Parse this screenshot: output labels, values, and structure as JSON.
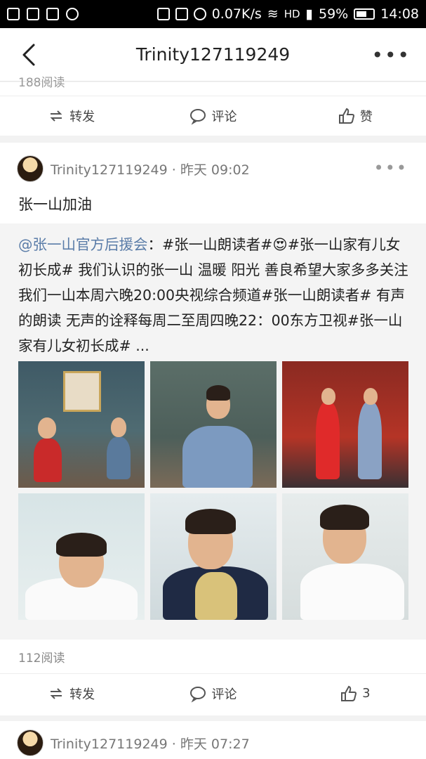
{
  "statusbar": {
    "speed": "0.07K/s",
    "network": "HD",
    "battery": "59%",
    "time": "14:08"
  },
  "navbar": {
    "title": "Trinity127119249",
    "more": "•••"
  },
  "top_card": {
    "reads_partial": "188阅读",
    "actions": {
      "forward": "转发",
      "comment": "评论",
      "like": "赞"
    }
  },
  "post1": {
    "username": "Trinity127119249",
    "sep": "·",
    "time": "昨天 09:02",
    "more": "•••",
    "text": "张一山加油",
    "repost": {
      "mention": "@张一山官方后援会",
      "body": "：#张一山朗读者#😍#张一山家有儿女初长成# 我们认识的张一山 温暖 阳光 善良希望大家多多关注我们一山本周六晚20:00央视综合频道#张一山朗读者# 有声的朗读 无声的诠释每周二至周四晚22：00东方卫视#张一山家有儿女初长成# ..."
    },
    "reads": "112阅读",
    "actions": {
      "forward": "转发",
      "comment": "评论",
      "like_count": "3"
    }
  },
  "post2": {
    "username": "Trinity127119249",
    "sep": "·",
    "time": "昨天 07:27"
  },
  "icons": {
    "back": "chevron-left",
    "forward": "repost",
    "comment": "speech-bubble",
    "like": "thumbs-up"
  }
}
